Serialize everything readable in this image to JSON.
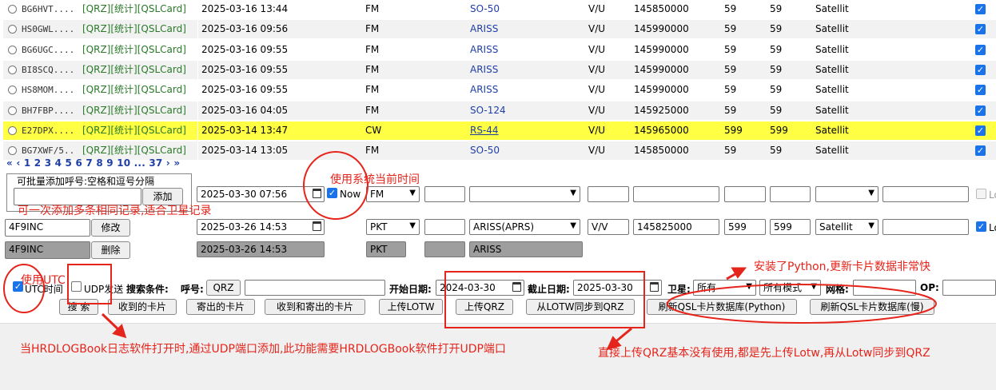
{
  "table": {
    "link_qrz": "[QRZ]",
    "link_stats": "[统计]",
    "link_qsl": "[QSLCard]",
    "rows": [
      {
        "call": "BG6HVT....",
        "datetime": "2025-03-16 13:44",
        "mode": "FM",
        "sat": "SO-50",
        "band": "V/U",
        "freq": "145850000",
        "rst_s": "59",
        "rst_r": "59",
        "prop": "Satellit",
        "checked": true,
        "highlight": false
      },
      {
        "call": "HS0GWL....",
        "datetime": "2025-03-16 09:56",
        "mode": "FM",
        "sat": "ARISS",
        "band": "V/U",
        "freq": "145990000",
        "rst_s": "59",
        "rst_r": "59",
        "prop": "Satellit",
        "checked": true,
        "highlight": false
      },
      {
        "call": "BG6UGC....",
        "datetime": "2025-03-16 09:55",
        "mode": "FM",
        "sat": "ARISS",
        "band": "V/U",
        "freq": "145990000",
        "rst_s": "59",
        "rst_r": "59",
        "prop": "Satellit",
        "checked": true,
        "highlight": false
      },
      {
        "call": "BI8SCQ....",
        "datetime": "2025-03-16 09:55",
        "mode": "FM",
        "sat": "ARISS",
        "band": "V/U",
        "freq": "145990000",
        "rst_s": "59",
        "rst_r": "59",
        "prop": "Satellit",
        "checked": true,
        "highlight": false
      },
      {
        "call": "HS8MOM....",
        "datetime": "2025-03-16 09:55",
        "mode": "FM",
        "sat": "ARISS",
        "band": "V/U",
        "freq": "145990000",
        "rst_s": "59",
        "rst_r": "59",
        "prop": "Satellit",
        "checked": true,
        "highlight": false
      },
      {
        "call": "BH7FBP....",
        "datetime": "2025-03-16 04:05",
        "mode": "FM",
        "sat": "SO-124",
        "band": "V/U",
        "freq": "145925000",
        "rst_s": "59",
        "rst_r": "59",
        "prop": "Satellit",
        "checked": true,
        "highlight": false
      },
      {
        "call": "E27DPX....",
        "datetime": "2025-03-14 13:47",
        "mode": "CW",
        "sat": "RS-44",
        "band": "V/U",
        "freq": "145965000",
        "rst_s": "599",
        "rst_r": "599",
        "prop": "Satellit",
        "checked": true,
        "highlight": true
      },
      {
        "call": "BG7XWF/5..",
        "datetime": "2025-03-14 13:05",
        "mode": "FM",
        "sat": "SO-50",
        "band": "V/U",
        "freq": "145850000",
        "rst_s": "59",
        "rst_r": "59",
        "prop": "Satellit",
        "checked": true,
        "highlight": false
      }
    ]
  },
  "pager": {
    "text": "« ‹ 1 2 3 4 5 6 7 8 9 10 ... 37 › »"
  },
  "batch": {
    "legend": "可批量添加呼号:空格和逗号分隔",
    "input_value": "",
    "add_label": "添加"
  },
  "entry_row": {
    "datetime": "2025-03-30  07:56",
    "now_label": "Now",
    "mode": "FM",
    "lotw_label": "Lo"
  },
  "edit_row": {
    "call": "4F9INC",
    "edit_label": "修改",
    "datetime": "2025-03-26  14:53",
    "mode": "PKT",
    "sat": "ARISS(APRS)",
    "band": "V/V",
    "freq": "145825000",
    "rst_s": "599",
    "rst_r": "599",
    "prop": "Satellit",
    "lotw_label": "Lo"
  },
  "delete_row": {
    "call": "4F9INC",
    "delete_label": "删除",
    "datetime": "2025-03-26  14:53",
    "mode": "PKT",
    "sat": "ARISS"
  },
  "search": {
    "utc_label": "UTC时间",
    "udp_label": "UDP发送",
    "search_title": "搜索条件:",
    "call_label": "呼号:",
    "qrz_label": "QRZ",
    "start_label": "开始日期:",
    "start_value": "2024-03-30",
    "end_label": "截止日期:",
    "end_value": "2025-03-30",
    "sat_label": "卫星:",
    "sat_value": "所有",
    "mode_value": "所有模式",
    "grid_label": "网格:",
    "op_label": "OP:"
  },
  "buttons": {
    "search": "搜 索",
    "received": "收到的卡片",
    "sent": "寄出的卡片",
    "both": "收到和寄出的卡片",
    "upload_lotw": "上传LOTW",
    "upload_qrz": "上传QRZ",
    "sync_qrz": "从LOTW同步到QRZ",
    "refresh_python": "刷新QSL卡片数据库(Python)",
    "refresh_slow": "刷新QSL卡片数据库(慢)"
  },
  "annotations": {
    "now_note": "使用系统当前时间",
    "multi_note": "可一次添加多条相同记录,适合卫星记录",
    "utc_note": "使用UTC",
    "python_note": "安装了Python,更新卡片数据非常快",
    "udp_note": "当HRDLOGBook日志软件打开时,通过UDP端口添加,此功能需要HRDLOGBook软件打开UDP端口",
    "qrz_note": "直接上传QRZ基本没有使用,都是先上传Lotw,再从Lotw同步到QRZ",
    "color": "#e5241b"
  }
}
